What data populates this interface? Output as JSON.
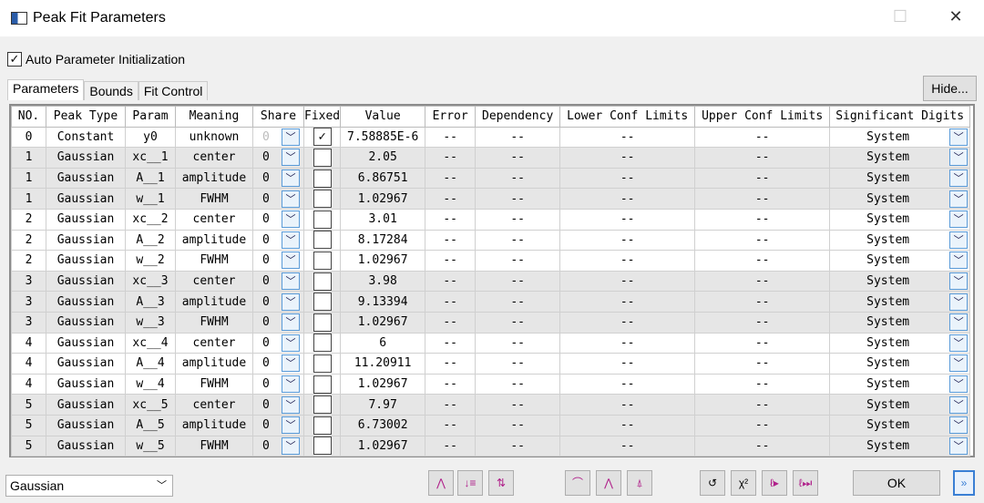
{
  "window": {
    "title": "Peak Fit Parameters"
  },
  "auto_init": {
    "label": "Auto Parameter Initialization",
    "checked": true
  },
  "tabs": [
    {
      "label": "Parameters",
      "active": true
    },
    {
      "label": "Bounds"
    },
    {
      "label": "Fit Control"
    }
  ],
  "hide_label": "Hide...",
  "columns": [
    "NO.",
    "Peak Type",
    "Param",
    "Meaning",
    "Share",
    "Fixed",
    "Value",
    "Error",
    "Dependency",
    "Lower Conf Limits",
    "Upper Conf Limits",
    "Significant Digits"
  ],
  "rows": [
    {
      "no": "0",
      "type": "Constant",
      "param": "y0",
      "meaning": "unknown",
      "share": "0",
      "fixed": true,
      "value": "7.58885E-6",
      "error": "--",
      "dependency": "--",
      "lower": "--",
      "upper": "--",
      "sig": "System"
    },
    {
      "no": "1",
      "type": "Gaussian",
      "param": "xc__1",
      "meaning": "center",
      "share": "0",
      "fixed": false,
      "value": "2.05",
      "error": "--",
      "dependency": "--",
      "lower": "--",
      "upper": "--",
      "sig": "System"
    },
    {
      "no": "1",
      "type": "Gaussian",
      "param": "A__1",
      "meaning": "amplitude",
      "share": "0",
      "fixed": false,
      "value": "6.86751",
      "error": "--",
      "dependency": "--",
      "lower": "--",
      "upper": "--",
      "sig": "System"
    },
    {
      "no": "1",
      "type": "Gaussian",
      "param": "w__1",
      "meaning": "FWHM",
      "share": "0",
      "fixed": false,
      "value": "1.02967",
      "error": "--",
      "dependency": "--",
      "lower": "--",
      "upper": "--",
      "sig": "System"
    },
    {
      "no": "2",
      "type": "Gaussian",
      "param": "xc__2",
      "meaning": "center",
      "share": "0",
      "fixed": false,
      "value": "3.01",
      "error": "--",
      "dependency": "--",
      "lower": "--",
      "upper": "--",
      "sig": "System"
    },
    {
      "no": "2",
      "type": "Gaussian",
      "param": "A__2",
      "meaning": "amplitude",
      "share": "0",
      "fixed": false,
      "value": "8.17284",
      "error": "--",
      "dependency": "--",
      "lower": "--",
      "upper": "--",
      "sig": "System"
    },
    {
      "no": "2",
      "type": "Gaussian",
      "param": "w__2",
      "meaning": "FWHM",
      "share": "0",
      "fixed": false,
      "value": "1.02967",
      "error": "--",
      "dependency": "--",
      "lower": "--",
      "upper": "--",
      "sig": "System"
    },
    {
      "no": "3",
      "type": "Gaussian",
      "param": "xc__3",
      "meaning": "center",
      "share": "0",
      "fixed": false,
      "value": "3.98",
      "error": "--",
      "dependency": "--",
      "lower": "--",
      "upper": "--",
      "sig": "System"
    },
    {
      "no": "3",
      "type": "Gaussian",
      "param": "A__3",
      "meaning": "amplitude",
      "share": "0",
      "fixed": false,
      "value": "9.13394",
      "error": "--",
      "dependency": "--",
      "lower": "--",
      "upper": "--",
      "sig": "System"
    },
    {
      "no": "3",
      "type": "Gaussian",
      "param": "w__3",
      "meaning": "FWHM",
      "share": "0",
      "fixed": false,
      "value": "1.02967",
      "error": "--",
      "dependency": "--",
      "lower": "--",
      "upper": "--",
      "sig": "System"
    },
    {
      "no": "4",
      "type": "Gaussian",
      "param": "xc__4",
      "meaning": "center",
      "share": "0",
      "fixed": false,
      "value": "6",
      "error": "--",
      "dependency": "--",
      "lower": "--",
      "upper": "--",
      "sig": "System"
    },
    {
      "no": "4",
      "type": "Gaussian",
      "param": "A__4",
      "meaning": "amplitude",
      "share": "0",
      "fixed": false,
      "value": "11.20911",
      "error": "--",
      "dependency": "--",
      "lower": "--",
      "upper": "--",
      "sig": "System"
    },
    {
      "no": "4",
      "type": "Gaussian",
      "param": "w__4",
      "meaning": "FWHM",
      "share": "0",
      "fixed": false,
      "value": "1.02967",
      "error": "--",
      "dependency": "--",
      "lower": "--",
      "upper": "--",
      "sig": "System"
    },
    {
      "no": "5",
      "type": "Gaussian",
      "param": "xc__5",
      "meaning": "center",
      "share": "0",
      "fixed": false,
      "value": "7.97",
      "error": "--",
      "dependency": "--",
      "lower": "--",
      "upper": "--",
      "sig": "System"
    },
    {
      "no": "5",
      "type": "Gaussian",
      "param": "A__5",
      "meaning": "amplitude",
      "share": "0",
      "fixed": false,
      "value": "6.73002",
      "error": "--",
      "dependency": "--",
      "lower": "--",
      "upper": "--",
      "sig": "System"
    },
    {
      "no": "5",
      "type": "Gaussian",
      "param": "w__5",
      "meaning": "FWHM",
      "share": "0",
      "fixed": false,
      "value": "1.02967",
      "error": "--",
      "dependency": "--",
      "lower": "--",
      "upper": "--",
      "sig": "System"
    }
  ],
  "function_select": "Gaussian",
  "toolbar": [
    {
      "icon": "peak-split-icon",
      "glyph": "⋀"
    },
    {
      "icon": "sort-icon",
      "glyph": "↓≡"
    },
    {
      "icon": "swap-peaks-icon",
      "glyph": "⇅"
    },
    {
      "icon": "init-peak-icon",
      "glyph": "⌒"
    },
    {
      "icon": "peak-icon",
      "glyph": "⋀"
    },
    {
      "icon": "peak-baseline-icon",
      "glyph": "⍋"
    },
    {
      "icon": "reset-icon",
      "glyph": "↺"
    },
    {
      "icon": "chi-square-icon",
      "glyph": "χ²"
    },
    {
      "icon": "fit-one-iteration-icon",
      "glyph": "ℓ▸"
    },
    {
      "icon": "fit-until-converge-icon",
      "glyph": "ℓ⏭"
    }
  ],
  "ok_label": "OK"
}
